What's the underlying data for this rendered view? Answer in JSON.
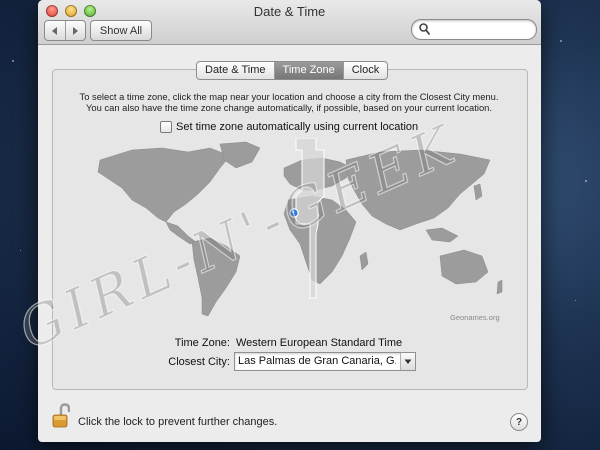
{
  "window": {
    "title": "Date & Time",
    "show_all_label": "Show All",
    "nav_back_icon": "chevron-left-icon",
    "nav_forward_icon": "chevron-right-icon",
    "search_placeholder": ""
  },
  "tabs": [
    {
      "label": "Date & Time",
      "active": false
    },
    {
      "label": "Time Zone",
      "active": true
    },
    {
      "label": "Clock",
      "active": false
    }
  ],
  "time_zone_pane": {
    "instructions_line1": "To select a time zone, click the map near your location and choose a city from the Closest City menu.",
    "instructions_line2": "You can also have the time zone change automatically, if possible, based on your current location.",
    "auto_checkbox_label": "Set time zone automatically using current location",
    "auto_checked": false,
    "map_credit": "Geonames.org",
    "time_zone_label": "Time Zone:",
    "time_zone_value": "Western European Standard Time",
    "closest_city_label": "Closest City:",
    "closest_city_value": "Las Palmas de Gran Canaria, G..."
  },
  "footer": {
    "lock_text": "Click the lock to prevent further changes.",
    "help_label": "?"
  },
  "overlay": {
    "watermark_text": "GIRL-N'-GEEK"
  },
  "colors": {
    "window_bg": "#ececec",
    "active_tab": "#808080",
    "map_land": "#9c9c9c",
    "map_highlight": "#c2c2c2",
    "location_pin": "#2f7be0"
  }
}
